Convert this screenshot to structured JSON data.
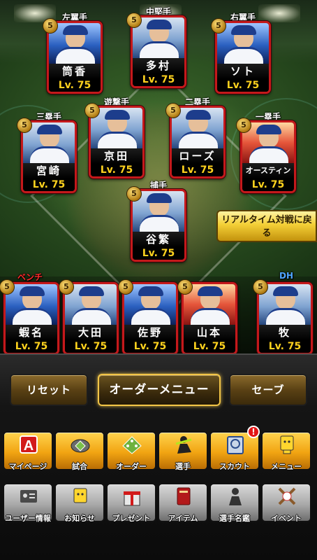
{
  "field_cards": [
    {
      "position": "左翼手",
      "pos_color": "white",
      "name": "筒香",
      "level": "Lv. 75",
      "photo": "blue",
      "cost": "5"
    },
    {
      "position": "中堅手",
      "pos_color": "white",
      "name": "多村",
      "level": "Lv. 75",
      "photo": "white",
      "cost": "5"
    },
    {
      "position": "右翼手",
      "pos_color": "white",
      "name": "ソト",
      "level": "Lv. 75",
      "photo": "blue",
      "cost": "5"
    },
    {
      "position": "遊撃手",
      "pos_color": "white",
      "name": "京田",
      "level": "Lv. 75",
      "photo": "white",
      "cost": "5"
    },
    {
      "position": "二塁手",
      "pos_color": "white",
      "name": "ローズ",
      "level": "Lv. 75",
      "photo": "white",
      "cost": "5"
    },
    {
      "position": "三塁手",
      "pos_color": "white",
      "name": "宮崎",
      "level": "Lv. 75",
      "photo": "white",
      "cost": "5"
    },
    {
      "position": "一塁手",
      "pos_color": "white",
      "name": "オースティン",
      "level": "Lv. 75",
      "photo": "red",
      "cost": "5"
    },
    {
      "position": "捕手",
      "pos_color": "white",
      "name": "谷繁",
      "level": "Lv. 75",
      "photo": "white",
      "cost": "5"
    }
  ],
  "bench_label": "ベンチ",
  "dh_label": "DH",
  "bench_cards": [
    {
      "name": "蝦名",
      "level": "Lv. 75",
      "photo": "blue",
      "cost": "5"
    },
    {
      "name": "大田",
      "level": "Lv. 75",
      "photo": "white",
      "cost": "5"
    },
    {
      "name": "佐野",
      "level": "Lv. 75",
      "photo": "blue",
      "cost": "5"
    },
    {
      "name": "山本",
      "level": "Lv. 75",
      "photo": "red",
      "cost": "5"
    },
    {
      "name": "牧",
      "level": "Lv. 75",
      "photo": "white",
      "cost": "5"
    }
  ],
  "realtime_button": "リアルタイム対戦に戻る",
  "order_buttons": {
    "reset": "リセット",
    "menu": "オーダーメニュー",
    "save": "セーブ"
  },
  "nav_row1": [
    {
      "label": "マイページ",
      "icon": "mypage-icon"
    },
    {
      "label": "試合",
      "icon": "stadium-icon"
    },
    {
      "label": "オーダー",
      "icon": "order-icon"
    },
    {
      "label": "選手",
      "icon": "player-icon"
    },
    {
      "label": "スカウト",
      "icon": "scout-icon",
      "badge": "!"
    },
    {
      "label": "メニュー",
      "icon": "menu-icon"
    }
  ],
  "nav_row2": [
    {
      "label": "ユーザー情報",
      "icon": "user-info-icon"
    },
    {
      "label": "お知らせ",
      "icon": "news-icon"
    },
    {
      "label": "プレゼント",
      "icon": "present-icon"
    },
    {
      "label": "アイテム",
      "icon": "item-icon"
    },
    {
      "label": "選手名鑑",
      "icon": "player-directory-icon"
    },
    {
      "label": "イベント",
      "icon": "event-icon"
    }
  ]
}
